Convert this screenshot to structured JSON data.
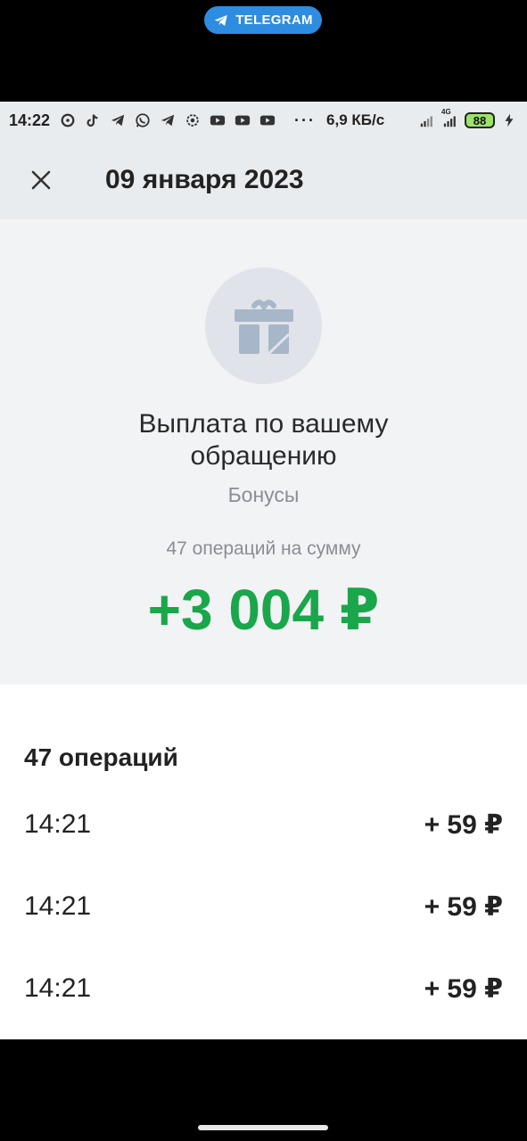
{
  "overlay": {
    "telegram_label": "TELEGRAM"
  },
  "status_bar": {
    "time": "14:22",
    "dots": "···",
    "speed": "6,9 КБ/с",
    "network": "4G",
    "battery": "88",
    "icons": [
      "messenger-icon",
      "tiktok-icon",
      "telegram-icon",
      "whatsapp-icon",
      "telegram-icon",
      "settings-icon",
      "youtube-icon",
      "youtube-icon",
      "youtube-icon"
    ]
  },
  "header": {
    "title": "09 января 2023"
  },
  "summary": {
    "title": "Выплата по вашему обращению",
    "category": "Бонусы",
    "operations_label": "47 операций на сумму",
    "total": "+3 004 ₽",
    "icon": "gift-icon"
  },
  "operations": {
    "heading": "47 операций",
    "items": [
      {
        "time": "14:21",
        "amount": "+ 59 ₽"
      },
      {
        "time": "14:21",
        "amount": "+ 59 ₽"
      },
      {
        "time": "14:21",
        "amount": "+ 59 ₽"
      }
    ]
  },
  "colors": {
    "accent_green": "#1aa64a",
    "header_bg": "#e9ecef",
    "telegram_blue": "#2e8de0"
  }
}
